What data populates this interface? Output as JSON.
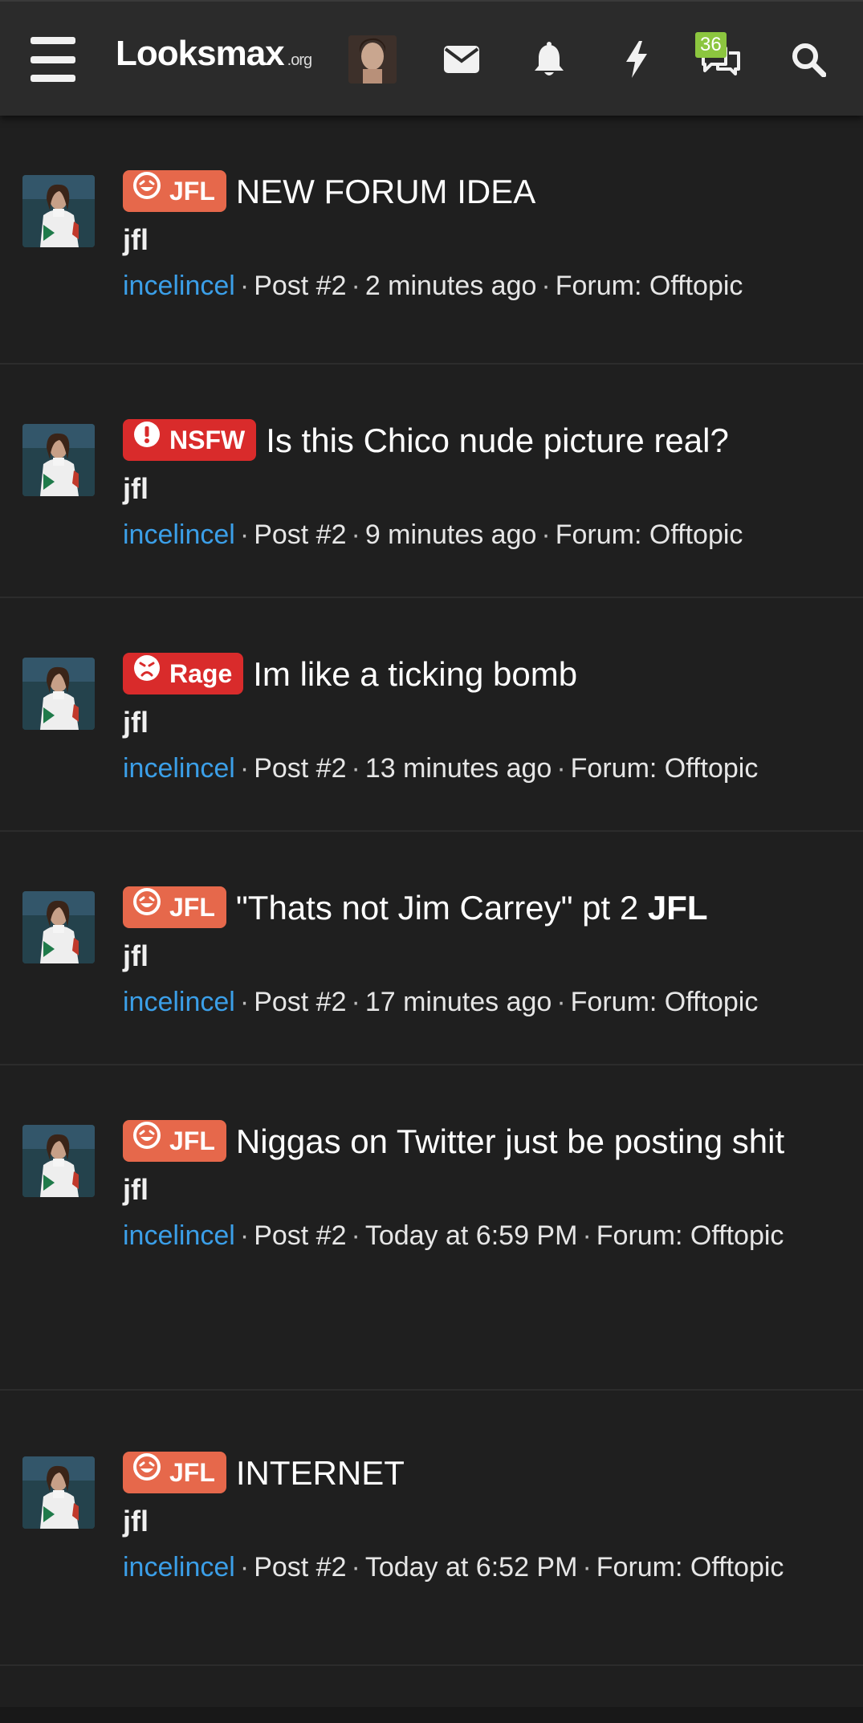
{
  "header": {
    "logo_text": "Looksmax",
    "logo_tld": ".org",
    "conversations_count": "36",
    "icons": [
      "menu-icon",
      "envelope-icon",
      "bell-icon",
      "bolt-icon",
      "conversations-icon",
      "search-icon"
    ]
  },
  "colors": {
    "background": "#1f1f1f",
    "navbar": "#2b2b2b",
    "username_link": "#3b9fe8",
    "badge_jfl": "#e6684b",
    "badge_red": "#d92b2b",
    "count_badge": "#8cc63f"
  },
  "meta_separator": "·",
  "items": [
    {
      "prefix": "JFL",
      "title": "NEW FORUM IDEA",
      "title_bold": "",
      "snippet": "jfl",
      "user": "incelincel",
      "post": "Post #2",
      "time": "2 minutes ago",
      "forum": "Forum: Offtopic"
    },
    {
      "prefix": "NSFW",
      "title": "Is this Chico nude picture real?",
      "title_bold": "",
      "snippet": "jfl",
      "user": "incelincel",
      "post": "Post #2",
      "time": "9 minutes ago",
      "forum": "Forum: Offtopic"
    },
    {
      "prefix": "Rage",
      "title": "Im like a ticking bomb",
      "title_bold": "",
      "snippet": "jfl",
      "user": "incelincel",
      "post": "Post #2",
      "time": "13 minutes ago",
      "forum": "Forum: Offtopic"
    },
    {
      "prefix": "JFL",
      "title": "\"Thats not Jim Carrey\" pt 2",
      "title_bold": "JFL",
      "snippet": "jfl",
      "user": "incelincel",
      "post": "Post #2",
      "time": "17 minutes ago",
      "forum": "Forum: Offtopic"
    },
    {
      "prefix": "JFL",
      "title": "Niggas on Twitter just be posting shit",
      "title_bold": "",
      "snippet": "jfl",
      "user": "incelincel",
      "post": "Post #2",
      "time": "Today at 6:59 PM",
      "forum": "Forum: Offtopic"
    },
    {
      "prefix": "JFL",
      "title": "INTERNET",
      "title_bold": "",
      "snippet": "jfl",
      "user": "incelincel",
      "post": "Post #2",
      "time": "Today at 6:52 PM",
      "forum": "Forum: Offtopic"
    }
  ]
}
